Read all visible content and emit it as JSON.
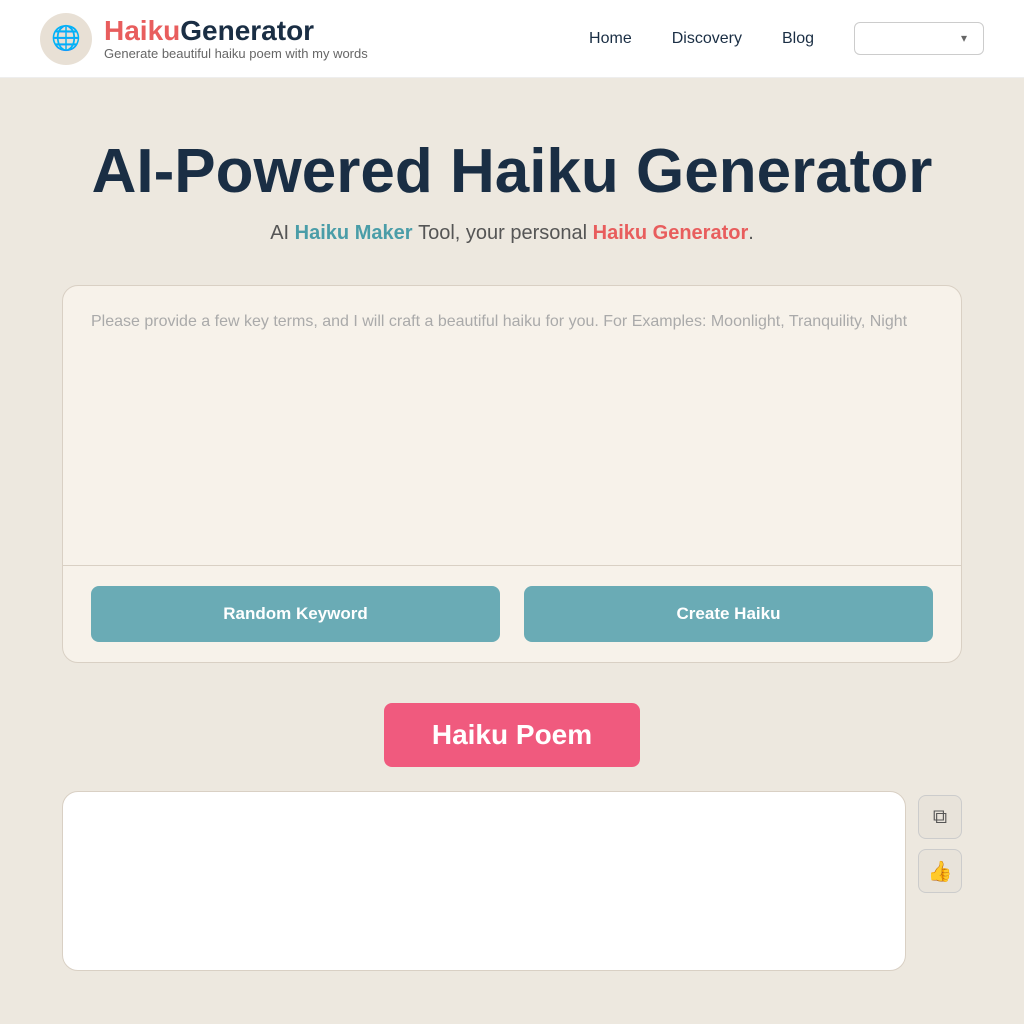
{
  "header": {
    "logo": {
      "icon_emoji": "🌐",
      "title_part1": "Haiku",
      "title_part2": "Generator",
      "subtitle": "Generate beautiful haiku poem with my words"
    },
    "nav": {
      "home_label": "Home",
      "discovery_label": "Discovery",
      "blog_label": "Blog",
      "dropdown_placeholder": "",
      "chevron_icon": "▾"
    }
  },
  "hero": {
    "title": "AI-Powered Haiku Generator",
    "subtitle_prefix": "AI",
    "subtitle_link1": "Haiku Maker",
    "subtitle_middle": "Tool, your personal",
    "subtitle_link2": "Haiku Generator",
    "subtitle_suffix": "."
  },
  "input_card": {
    "textarea_placeholder": "Please provide a few key terms, and I will craft a beautiful haiku for you. For Examples: Moonlight, Tranquility, Night",
    "random_button_label": "Random Keyword",
    "create_button_label": "Create Haiku"
  },
  "haiku_section": {
    "badge_label": "Haiku Poem",
    "output_placeholder": "",
    "copy_icon": "⧉",
    "like_icon": "👍"
  }
}
